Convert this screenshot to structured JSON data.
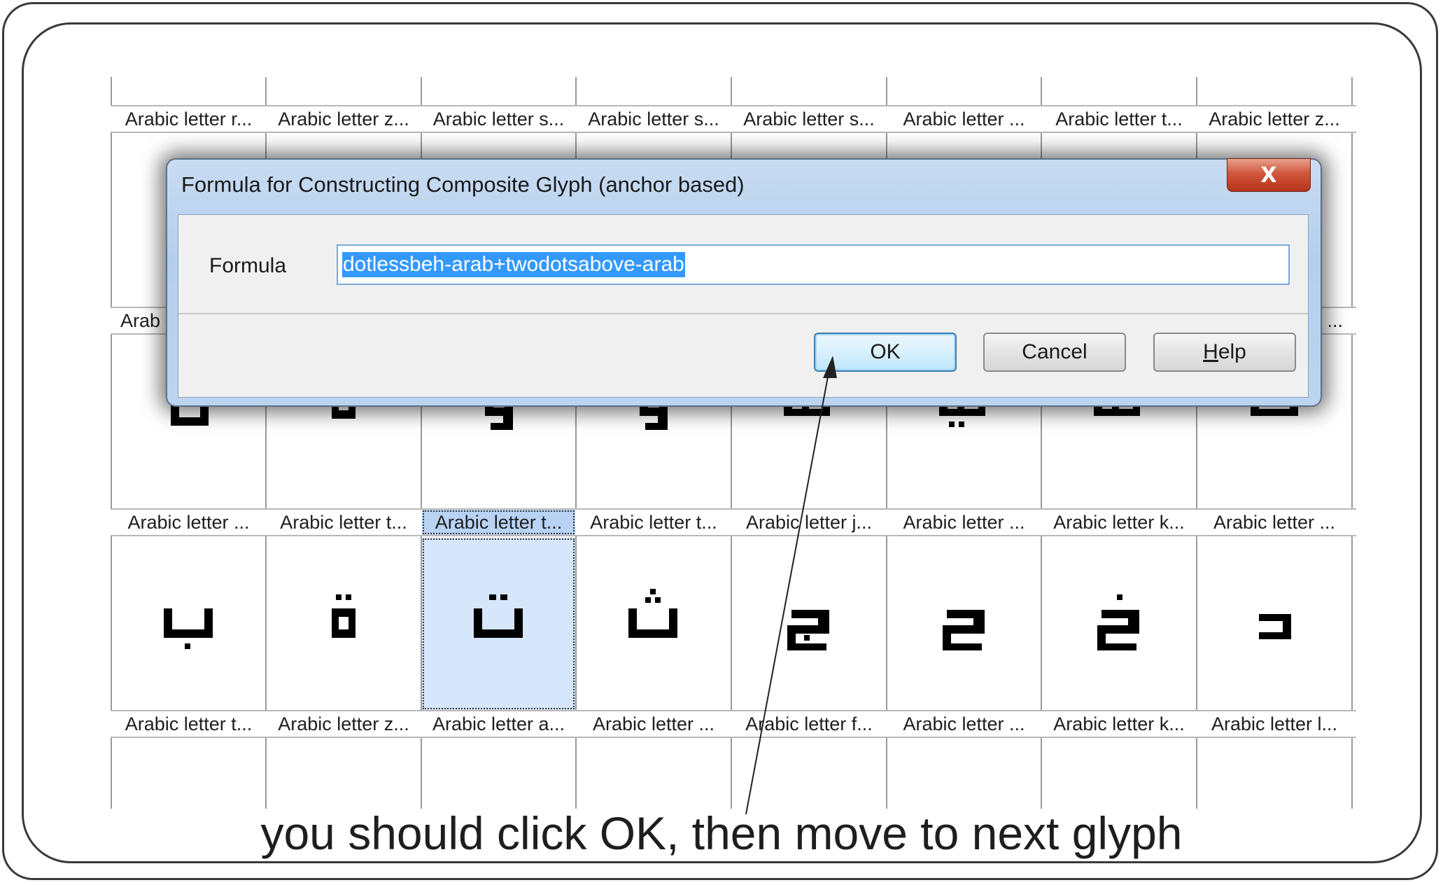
{
  "glyph_grid": {
    "label_rows": [
      [
        "Arabic letter r...",
        "Arabic letter z...",
        "Arabic letter s...",
        "Arabic letter s...",
        "Arabic letter s...",
        "Arabic letter ...",
        "Arabic letter t...",
        "Arabic letter z..."
      ],
      [
        "Arab",
        "",
        "",
        "",
        "",
        "",
        "",
        "..."
      ],
      [
        "Arabic letter ...",
        "Arabic letter t...",
        "Arabic letter t...",
        "Arabic letter t...",
        "Arabic letter j...",
        "Arabic letter ...",
        "Arabic letter k...",
        "Arabic letter ..."
      ],
      [
        "Arabic letter t...",
        "Arabic letter z...",
        "Arabic letter a...",
        "Arabic letter ...",
        "Arabic letter f...",
        "Arabic letter ...",
        "Arabic letter k...",
        "Arabic letter l..."
      ]
    ],
    "selected_cell": {
      "row": 2,
      "column": 2
    }
  },
  "dialog": {
    "title": "Formula for Constructing Composite Glyph (anchor based)",
    "close_label": "X",
    "formula_label": "Formula",
    "formula_value": "dotlessbeh-arab+twodotsabove-arab",
    "ok_label": "OK",
    "cancel_label": "Cancel",
    "help_label_prefix": "",
    "help_mnemonic": "H",
    "help_label_rest": "elp"
  },
  "annotation": {
    "caption": "you should click OK, then move to next glyph"
  },
  "colors": {
    "selection_blue": "#3399ff",
    "selected_cell": "#d6e6fb",
    "close_red": "#c8452b",
    "frame": "#3a3a3a"
  }
}
